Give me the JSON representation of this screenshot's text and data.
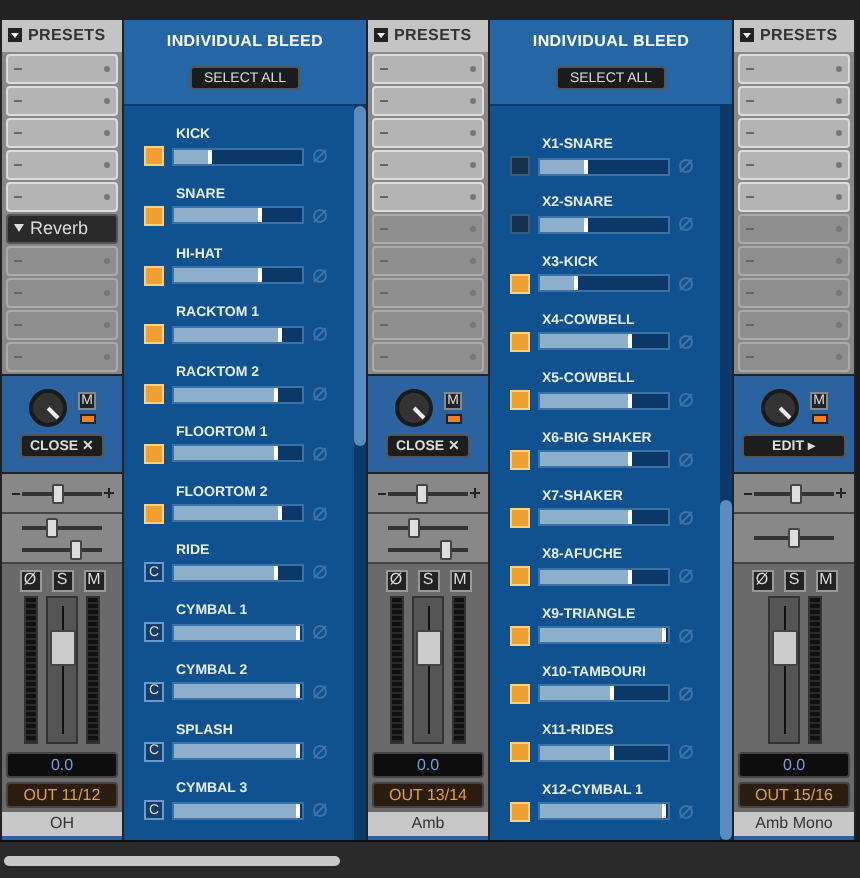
{
  "columns": [
    {
      "kind": "stereo-strip",
      "presets_label": "PRESETS",
      "knob_button": {
        "kind": "close",
        "label": "CLOSE ✕"
      },
      "mute_label": "M",
      "led_on": true,
      "pan": {
        "level": 0.45
      },
      "sliders": [
        {
          "level": 0.35
        },
        {
          "level": 0.72
        }
      ],
      "buttons": [
        "Ø",
        "S",
        "M"
      ],
      "fader": {
        "level": 0.72
      },
      "value": "0.0",
      "output": "OUT 11/12",
      "name": "OH",
      "slots": [
        {
          "kind": "insert"
        },
        {
          "kind": "insert"
        },
        {
          "kind": "insert"
        },
        {
          "kind": "insert"
        },
        {
          "kind": "insert"
        },
        {
          "kind": "send",
          "label": "Reverb"
        },
        {
          "kind": "send"
        },
        {
          "kind": "send"
        },
        {
          "kind": "send"
        },
        {
          "kind": "send"
        }
      ]
    },
    {
      "kind": "bleed",
      "title": "INDIVIDUAL BLEED",
      "select_all": "SELECT ALL",
      "items": [
        {
          "label": "KICK",
          "kind": "toggle",
          "on": true,
          "level": 0.3
        },
        {
          "label": "SNARE",
          "kind": "toggle",
          "on": true,
          "level": 0.68
        },
        {
          "label": "HI-HAT",
          "kind": "toggle",
          "on": true,
          "level": 0.68
        },
        {
          "label": "RACKTOM 1",
          "kind": "toggle",
          "on": true,
          "level": 0.84
        },
        {
          "label": "RACKTOM 2",
          "kind": "toggle",
          "on": true,
          "level": 0.81
        },
        {
          "label": "FLOORTOM 1",
          "kind": "toggle",
          "on": true,
          "level": 0.81
        },
        {
          "label": "FLOORTOM 2",
          "kind": "toggle",
          "on": true,
          "level": 0.84
        },
        {
          "label": "RIDE",
          "kind": "c-button",
          "button_label": "C",
          "level": 0.81
        },
        {
          "label": "CYMBAL 1",
          "kind": "c-button",
          "button_label": "C",
          "level": 0.98
        },
        {
          "label": "CYMBAL 2",
          "kind": "c-button",
          "button_label": "C",
          "level": 0.98
        },
        {
          "label": "SPLASH",
          "kind": "c-button",
          "button_label": "C",
          "level": 0.98
        },
        {
          "label": "CYMBAL 3",
          "kind": "c-button",
          "button_label": "C",
          "level": 0.98
        }
      ]
    },
    {
      "kind": "stereo-strip",
      "presets_label": "PRESETS",
      "knob_button": {
        "kind": "close",
        "label": "CLOSE ✕"
      },
      "mute_label": "M",
      "led_on": true,
      "pan": {
        "level": 0.42
      },
      "sliders": [
        {
          "level": 0.3
        },
        {
          "level": 0.75
        }
      ],
      "buttons": [
        "Ø",
        "S",
        "M"
      ],
      "fader": {
        "level": 0.72
      },
      "value": "0.0",
      "output": "OUT 13/14",
      "name": "Amb",
      "slots": [
        {
          "kind": "insert"
        },
        {
          "kind": "insert"
        },
        {
          "kind": "insert"
        },
        {
          "kind": "insert"
        },
        {
          "kind": "insert"
        },
        {
          "kind": "send"
        },
        {
          "kind": "send"
        },
        {
          "kind": "send"
        },
        {
          "kind": "send"
        },
        {
          "kind": "send"
        }
      ]
    },
    {
      "kind": "bleed",
      "title": "INDIVIDUAL BLEED",
      "select_all": "SELECT ALL",
      "items": [
        {
          "label": "X1-SNARE",
          "kind": "toggle",
          "on": false,
          "level": 0.37
        },
        {
          "label": "X2-SNARE",
          "kind": "toggle",
          "on": false,
          "level": 0.37
        },
        {
          "label": "X3-KICK",
          "kind": "toggle",
          "on": true,
          "level": 0.3
        },
        {
          "label": "X4-COWBELL",
          "kind": "toggle",
          "on": true,
          "level": 0.72
        },
        {
          "label": "X5-COWBELL",
          "kind": "toggle",
          "on": true,
          "level": 0.72
        },
        {
          "label": "X6-BIG SHAKER",
          "kind": "toggle",
          "on": true,
          "level": 0.72
        },
        {
          "label": "X7-SHAKER",
          "kind": "toggle",
          "on": true,
          "level": 0.72
        },
        {
          "label": "X8-AFUCHE",
          "kind": "toggle",
          "on": true,
          "level": 0.72
        },
        {
          "label": "X9-TRIANGLE",
          "kind": "toggle",
          "on": true,
          "level": 0.98
        },
        {
          "label": "X10-TAMBOURI",
          "kind": "toggle",
          "on": true,
          "level": 0.58
        },
        {
          "label": "X11-RIDES",
          "kind": "toggle",
          "on": true,
          "level": 0.58
        },
        {
          "label": "X12-CYMBAL 1",
          "kind": "toggle",
          "on": true,
          "level": 0.98
        }
      ]
    },
    {
      "kind": "mono-strip",
      "presets_label": "PRESETS",
      "knob_button": {
        "kind": "edit",
        "label": "EDIT ▸"
      },
      "mute_label": "M",
      "led_on": true,
      "pan": {
        "level": 0.55
      },
      "sliders": [
        {
          "level": 0.5
        }
      ],
      "buttons": [
        "Ø",
        "S",
        "M"
      ],
      "fader": {
        "level": 0.72
      },
      "value": "0.0",
      "output": "OUT 15/16",
      "name": "Amb Mono",
      "slots": [
        {
          "kind": "insert"
        },
        {
          "kind": "insert"
        },
        {
          "kind": "insert"
        },
        {
          "kind": "insert"
        },
        {
          "kind": "insert"
        },
        {
          "kind": "send"
        },
        {
          "kind": "send"
        },
        {
          "kind": "send"
        },
        {
          "kind": "send"
        },
        {
          "kind": "send"
        }
      ]
    }
  ]
}
